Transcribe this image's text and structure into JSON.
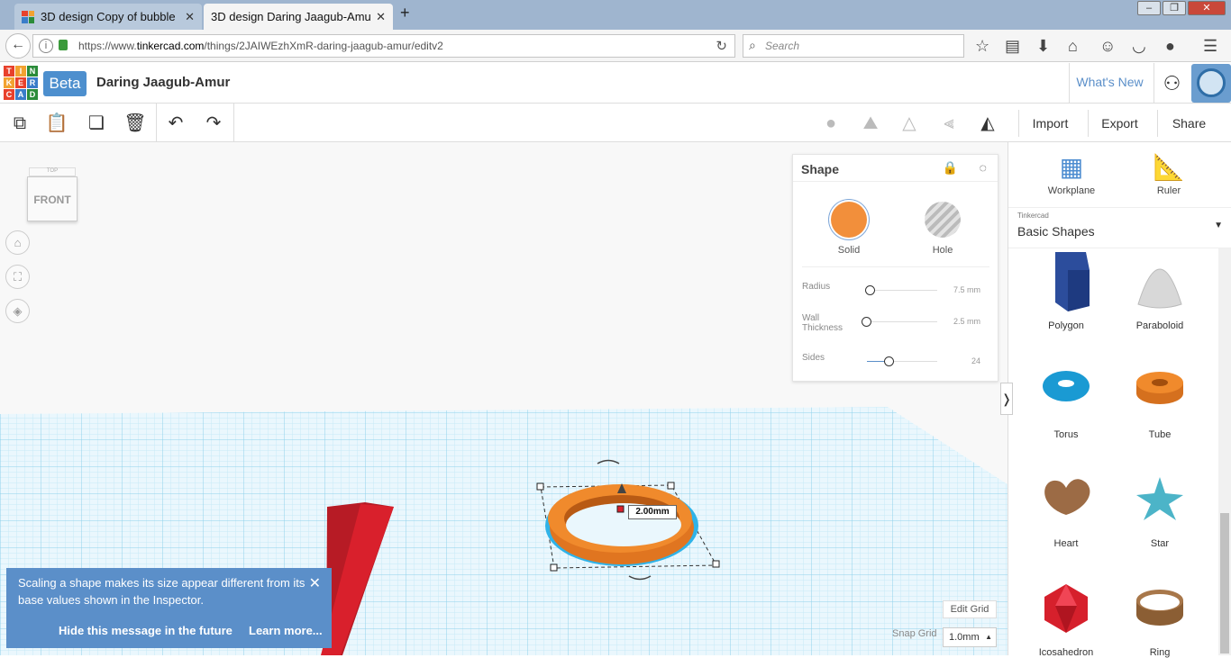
{
  "browser": {
    "tabs": [
      {
        "title": "3D design Copy of bubble ...",
        "active": false
      },
      {
        "title": "3D design Daring Jaagub-Amur...",
        "active": true
      }
    ],
    "url_prefix": "https://www.",
    "url_domain": "tinkercad.com",
    "url_path": "/things/2JAIWEzhXmR-daring-jaagub-amur/editv2",
    "search_placeholder": "Search"
  },
  "app": {
    "logo_letters": [
      "T",
      "I",
      "N",
      "K",
      "E",
      "R",
      "C",
      "A",
      "D"
    ],
    "logo_colors": [
      "#e8412c",
      "#f2a230",
      "#2b8c3a",
      "#f2a230",
      "#e8412c",
      "#3a7dc9",
      "#e8412c",
      "#3a7dc9",
      "#2b8c3a"
    ],
    "beta": "Beta",
    "project_name": "Daring Jaagub-Amur",
    "whats_new": "What's New"
  },
  "toolbar": {
    "import": "Import",
    "export": "Export",
    "share": "Share"
  },
  "viewcube": {
    "top": "TOP",
    "front": "FRONT"
  },
  "inspector": {
    "title": "Shape",
    "solid": "Solid",
    "hole": "Hole",
    "params": [
      {
        "label": "Radius",
        "value": "7.5 mm",
        "level": 0.05
      },
      {
        "label": "Wall Thickness",
        "value": "2.5 mm",
        "level": 0.0
      },
      {
        "label": "Sides",
        "value": "24",
        "level": 0.3
      }
    ]
  },
  "sidebar": {
    "workplane": "Workplane",
    "ruler": "Ruler",
    "library_source": "Tinkercad",
    "library_name": "Basic Shapes",
    "shapes": [
      "Polygon",
      "Paraboloid",
      "Torus",
      "Tube",
      "Heart",
      "Star",
      "Icosahedron",
      "Ring"
    ]
  },
  "scene": {
    "dimension": "2.00mm",
    "ring_color": "#f08a2c",
    "box_color": "#d9202c",
    "grid_color": "#bfe6f5"
  },
  "toast": {
    "message": "Scaling a shape makes its size appear different from its base values shown in the Inspector.",
    "hide": "Hide this message in the future",
    "learn": "Learn more..."
  },
  "grid": {
    "edit": "Edit Grid",
    "snap_label": "Snap Grid",
    "snap_value": "1.0mm"
  }
}
